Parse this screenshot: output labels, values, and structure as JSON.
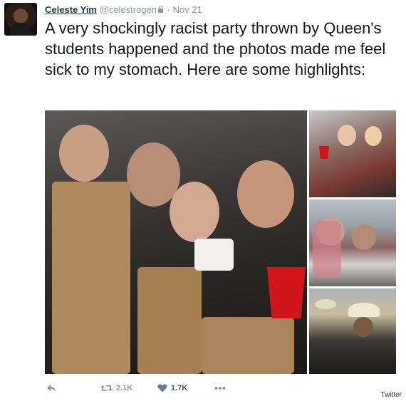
{
  "tweet": {
    "display_name": "Celeste Yim",
    "handle": "@celestrogen",
    "separator": "·",
    "date": "Nov 21",
    "text": "A very shockingly racist party thrown by Queen's students happened and the photos made me feel sick to my stomach. Here are some highlights:"
  },
  "actions": {
    "retweet_count": "2.1K",
    "like_count": "1.7K"
  },
  "icons": {
    "reply": "reply-arrow-icon",
    "retweet": "retweet-icon",
    "like": "heart-icon",
    "more": "more-dots-icon",
    "lock": "lock-icon"
  },
  "colors": {
    "text": "#14171a",
    "muted": "#8899a6",
    "name": "#1b3a4b"
  },
  "source_label": "Twitter"
}
